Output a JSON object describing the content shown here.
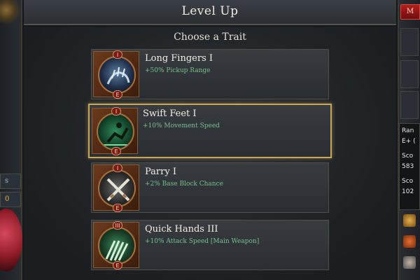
{
  "window": {
    "title": "Level Up"
  },
  "main": {
    "prompt": "Choose a Trait"
  },
  "traits": [
    {
      "name": "Long Fingers I",
      "desc": "+50% Pickup Range",
      "rank_top": "I",
      "rank_bottom": "E",
      "icon": "hand-grab-icon",
      "selected": false
    },
    {
      "name": "Swift Feet I",
      "desc": "+10% Movement Speed",
      "rank_top": "I",
      "rank_bottom": "E",
      "icon": "running-feet-icon",
      "selected": true
    },
    {
      "name": "Parry I",
      "desc": "+2% Base Block Chance",
      "rank_top": "I",
      "rank_bottom": "E",
      "icon": "crossed-swords-icon",
      "selected": false
    },
    {
      "name": "Quick Hands III",
      "desc": "+10% Attack Speed [Main Weapon]",
      "rank_top": "III",
      "rank_bottom": "E",
      "icon": "hands-speed-icon",
      "selected": false
    }
  ],
  "left_panel": {
    "tile1": "s",
    "tile2": "0"
  },
  "right_panel": {
    "top_button": "M",
    "rank_label": "Ran",
    "rank_value": "E+ (",
    "score1_label": "Sco",
    "score1_value": "583",
    "score2_label": "Sco",
    "score2_value": "102"
  },
  "colors": {
    "accent_gold": "#c8a75a",
    "desc_green": "#76c08c",
    "card_bg": "#32363a"
  }
}
